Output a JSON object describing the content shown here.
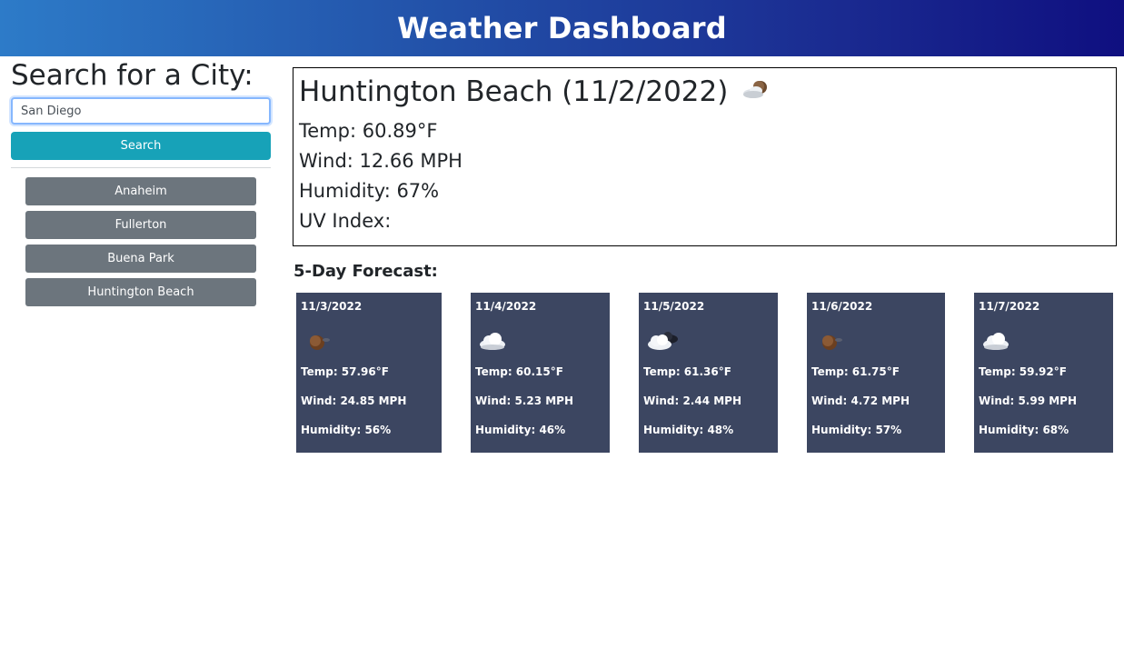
{
  "header": {
    "title": "Weather Dashboard"
  },
  "sidebar": {
    "heading": "Search for a City:",
    "search_value": "San Diego",
    "search_button": "Search",
    "history": [
      "Anaheim",
      "Fullerton",
      "Buena Park",
      "Huntington Beach"
    ]
  },
  "current": {
    "title": "Huntington Beach (11/2/2022)",
    "icon": "few-clouds-night-icon",
    "temp": "Temp: 60.89°F",
    "wind": "Wind: 12.66 MPH",
    "humidity": "Humidity: 67%",
    "uv": "UV Index:"
  },
  "forecast": {
    "title": "5-Day Forecast:",
    "days": [
      {
        "date": "11/3/2022",
        "icon": "clear-night-icon",
        "temp": "Temp: 57.96°F",
        "wind": "Wind: 24.85 MPH",
        "humidity": "Humidity: 56%"
      },
      {
        "date": "11/4/2022",
        "icon": "cloud-icon",
        "temp": "Temp: 60.15°F",
        "wind": "Wind: 5.23 MPH",
        "humidity": "Humidity: 46%"
      },
      {
        "date": "11/5/2022",
        "icon": "broken-clouds-icon",
        "temp": "Temp: 61.36°F",
        "wind": "Wind: 2.44 MPH",
        "humidity": "Humidity: 48%"
      },
      {
        "date": "11/6/2022",
        "icon": "clear-night-icon",
        "temp": "Temp: 61.75°F",
        "wind": "Wind: 4.72 MPH",
        "humidity": "Humidity: 57%"
      },
      {
        "date": "11/7/2022",
        "icon": "cloud-icon",
        "temp": "Temp: 59.92°F",
        "wind": "Wind: 5.99 MPH",
        "humidity": "Humidity: 68%"
      }
    ]
  },
  "colors": {
    "header_gradient_start": "#2d7bc8",
    "header_gradient_end": "#0f0f80",
    "search_button": "#17a2b8",
    "history_button": "#6c757d",
    "forecast_card": "#3c4661"
  }
}
